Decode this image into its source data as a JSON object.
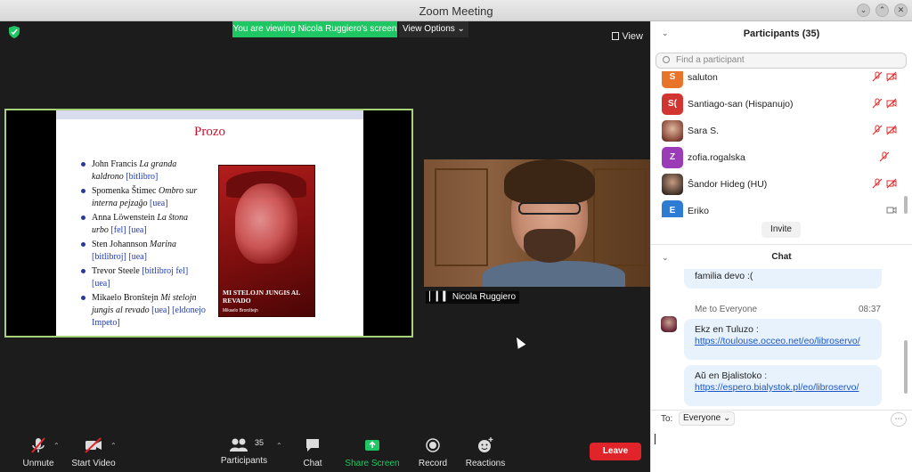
{
  "window": {
    "title": "Zoom Meeting"
  },
  "stage": {
    "banner": "You are viewing Nicola Ruggiero's screen",
    "view_options": "View Options",
    "view_button": "View",
    "participant_name": "Nicola Ruggiero"
  },
  "slide": {
    "title": "Prozo",
    "items": [
      {
        "author": "John Francis",
        "work": "La granda kaldrono",
        "links": [
          "[bitlibro]"
        ]
      },
      {
        "author": "Spomenka Štimec",
        "work": "Ombro sur interna pejzaĝo",
        "links": [
          "[uea]"
        ]
      },
      {
        "author": "Anna Löwenstein",
        "work": "La ŝtona urbo",
        "links": [
          "[fel]",
          "[uea]"
        ]
      },
      {
        "author": "Sten Johannson",
        "work": "Marina",
        "links": [
          "[bitlibroj]",
          "[uea]"
        ]
      },
      {
        "author": "Trevor Steele",
        "work": "",
        "links": [
          "[bitlibroj fel]",
          "[uea]"
        ]
      },
      {
        "author": "Mikaelo Bronŝtejn",
        "work": "Mi stelojn jungis al revado",
        "links": [
          "[uea]",
          "[eldonejo Impeto]"
        ]
      }
    ],
    "book_title": "MI STELOJN JUNGIS AL REVADO",
    "book_author": "Mikaelo Bronŝtejn"
  },
  "toolbar": {
    "unmute": "Unmute",
    "start_video": "Start Video",
    "participants": "Participants",
    "participants_count": "35",
    "chat": "Chat",
    "share_screen": "Share Screen",
    "record": "Record",
    "reactions": "Reactions",
    "leave": "Leave"
  },
  "participants_panel": {
    "title": "Participants (35)",
    "search_placeholder": "Find a participant",
    "rows": [
      {
        "name": "saluton",
        "initials": "S",
        "color": "#e8732a"
      },
      {
        "name": "Santiago-san (Hispanujo)",
        "initials": "S(",
        "color": "#d1352f"
      },
      {
        "name": "Sara S.",
        "initials": "",
        "color": "#8a4a3a"
      },
      {
        "name": "zofia.rogalska",
        "initials": "Z",
        "color": "#9c3bb8"
      },
      {
        "name": "Ŝandor Hideg (HU)",
        "initials": "",
        "color": "#4a3a30"
      },
      {
        "name": "Eriko",
        "initials": "E",
        "color": "#2d7bd3"
      }
    ],
    "invite": "Invite"
  },
  "chat_panel": {
    "title": "Chat",
    "prev_message_tail": "familia devo :(",
    "sender": "Me to Everyone",
    "time": "08:37",
    "messages": [
      {
        "prefix": "Ekz en Tuluzo : ",
        "link": "https://toulouse.occeo.net/eo/libroservo/"
      },
      {
        "prefix": "Aŭ en Bjalistoko : ",
        "link": "https://espero.bialystok.pl/eo/libroservo/"
      }
    ],
    "to_label": "To:",
    "to_value": "Everyone"
  },
  "colors": {
    "banner": "#1ec763",
    "leave": "#e0242a",
    "share_icon": "#1ec763",
    "bubble": "#e8f2fd"
  }
}
